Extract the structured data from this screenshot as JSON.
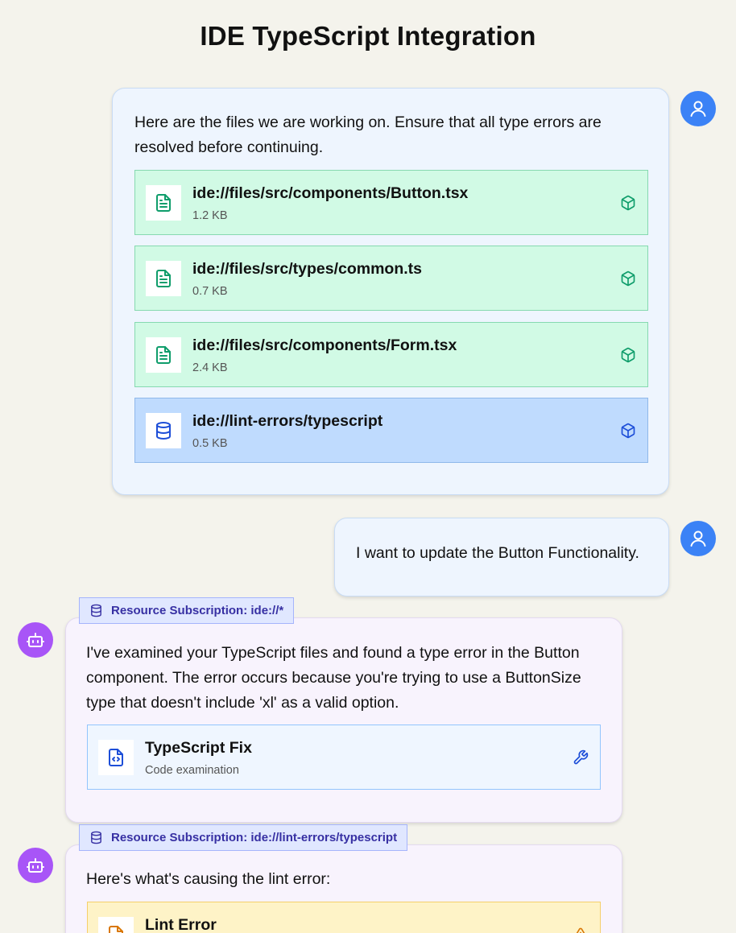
{
  "page": {
    "title": "IDE TypeScript Integration"
  },
  "colors": {
    "user_avatar": "#3b82f6",
    "bot_avatar": "#a855f7",
    "file_card_bg": "#d1fae5",
    "db_card_bg": "#bfdbfe",
    "subscription_bg": "#e0e7ff",
    "lint_card_bg": "#fef3c7"
  },
  "messages": [
    {
      "role": "user",
      "avatar_icon": "user-icon",
      "text_lines": [
        "Here are the files we are working on. Ensure that all type errors are",
        "resolved before continuing."
      ],
      "resources": [
        {
          "kind": "file",
          "icon": "file-text-icon",
          "name": "ide://files/src/components/Button.tsx",
          "size": "1.2 KB",
          "action_icon": "package-icon"
        },
        {
          "kind": "file",
          "icon": "file-text-icon",
          "name": "ide://files/src/types/common.ts",
          "size": "0.7 KB",
          "action_icon": "package-icon"
        },
        {
          "kind": "file",
          "icon": "file-text-icon",
          "name": "ide://files/src/components/Form.tsx",
          "size": "2.4 KB",
          "action_icon": "package-icon"
        },
        {
          "kind": "db",
          "icon": "database-icon",
          "name": "ide://lint-errors/typescript",
          "size": "0.5 KB",
          "action_icon": "package-icon"
        }
      ]
    },
    {
      "role": "user",
      "avatar_icon": "user-icon",
      "text": "I want to update the Button Functionality."
    },
    {
      "role": "assistant",
      "avatar_icon": "bot-icon",
      "subscription": {
        "icon": "database-icon",
        "label": "Resource Subscription: ide://*"
      },
      "text_lines": [
        "I've examined your TypeScript files and found a type error in the Button",
        "component. The error occurs because you're trying to use a ButtonSize",
        "type that doesn't include 'xl' as a valid option."
      ],
      "tool": {
        "icon": "file-code-icon",
        "name": "TypeScript Fix",
        "subtitle": "Code examination",
        "action_icon": "wrench-icon"
      }
    },
    {
      "role": "assistant",
      "avatar_icon": "bot-icon",
      "subscription": {
        "icon": "database-icon",
        "label": "Resource Subscription: ide://lint-errors/typescript"
      },
      "text": "Here's what's causing the lint error:",
      "tool": {
        "icon": "file-alert-icon",
        "name": "Lint Error",
        "action_icon": "warning-icon"
      }
    }
  ]
}
